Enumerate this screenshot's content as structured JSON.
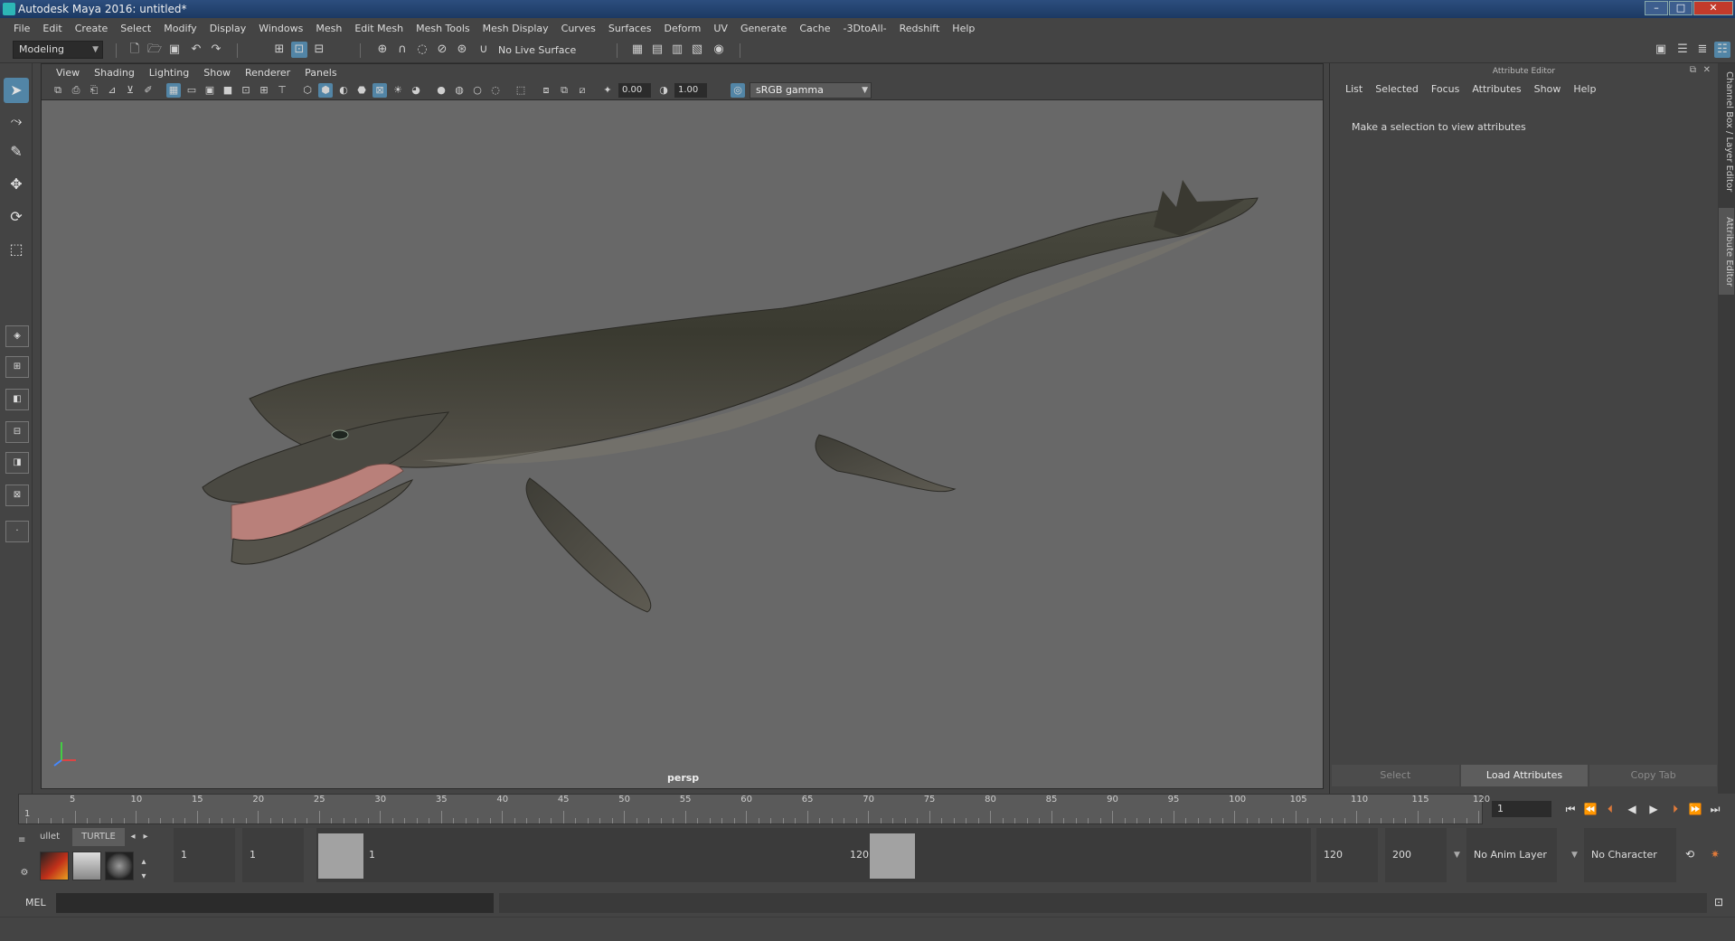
{
  "window": {
    "title": "Autodesk Maya 2016: untitled*"
  },
  "menubar": [
    "File",
    "Edit",
    "Create",
    "Select",
    "Modify",
    "Display",
    "Windows",
    "Mesh",
    "Edit Mesh",
    "Mesh Tools",
    "Mesh Display",
    "Curves",
    "Surfaces",
    "Deform",
    "UV",
    "Generate",
    "Cache",
    "-3DtoAll-",
    "Redshift",
    "Help"
  ],
  "shelf": {
    "mode": "Modeling",
    "live_surface": "No Live Surface"
  },
  "viewport": {
    "menu": [
      "View",
      "Shading",
      "Lighting",
      "Show",
      "Renderer",
      "Panels"
    ],
    "exposure": "0.00",
    "gamma": "1.00",
    "color_space": "sRGB gamma",
    "camera": "persp"
  },
  "attribute_editor": {
    "title": "Attribute Editor",
    "menu": [
      "List",
      "Selected",
      "Focus",
      "Attributes",
      "Show",
      "Help"
    ],
    "message": "Make a selection to view attributes",
    "buttons": {
      "select": "Select",
      "load": "Load Attributes",
      "copy": "Copy Tab"
    }
  },
  "side_tabs": {
    "channel_box": "Channel Box / Layer Editor",
    "attribute_editor": "Attribute Editor"
  },
  "timeline": {
    "ticks": [
      "5",
      "10",
      "15",
      "20",
      "25",
      "30",
      "35",
      "40",
      "45",
      "50",
      "55",
      "60",
      "65",
      "70",
      "75",
      "80",
      "85",
      "90",
      "95",
      "100",
      "105",
      "110",
      "115",
      "120"
    ],
    "start_label": "1",
    "current_frame": "1"
  },
  "range": {
    "shelf_tabs": [
      "ullet",
      "TURTLE"
    ],
    "start_time": "1",
    "playback_start": "1",
    "range_start_label": "1",
    "range_end_label": "120",
    "playback_end": "120",
    "end_time": "200",
    "anim_layer": "No Anim Layer",
    "character_set": "No Character Set"
  },
  "cmdline": {
    "label": "MEL"
  },
  "icons": {
    "playback": [
      "skip-to-start-icon",
      "step-back-key-icon",
      "step-back-frame-icon",
      "play-back-icon",
      "play-forward-icon",
      "step-forward-key-icon",
      "skip-to-end-icon"
    ]
  },
  "colors": {
    "accent": "#5285a6",
    "viewport_bg": "#686868",
    "maya_teal": "#2db6b6"
  }
}
